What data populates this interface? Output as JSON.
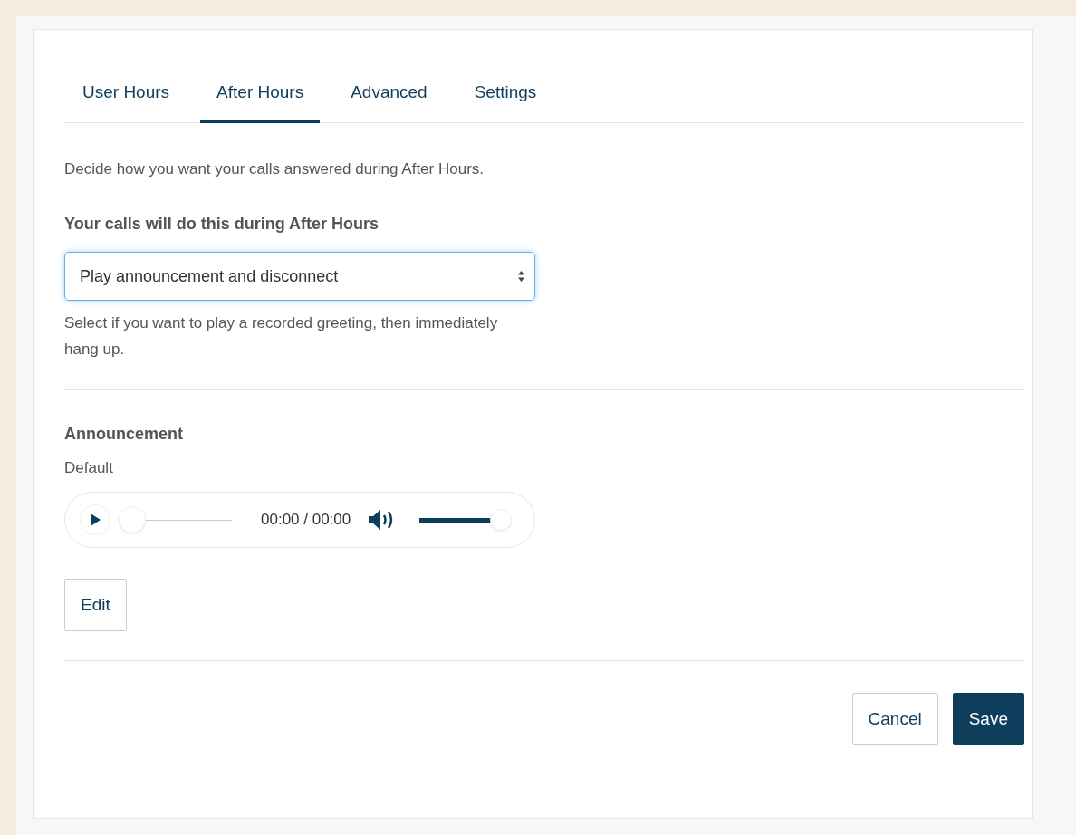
{
  "tabs": [
    {
      "label": "User Hours",
      "selected": false
    },
    {
      "label": "After Hours",
      "selected": true
    },
    {
      "label": "Advanced",
      "selected": false
    },
    {
      "label": "Settings",
      "selected": false
    }
  ],
  "intro": "Decide how you want your calls answered during After Hours.",
  "behavior": {
    "label": "Your calls will do this during After Hours",
    "value": "Play announcement and disconnect",
    "focused": true,
    "help": "Select if you want to play a recorded greeting, then immediately hang up."
  },
  "announcement": {
    "heading": "Announcement",
    "name": "Default",
    "player": {
      "progress": {
        "level": 0
      },
      "time": "00:00 / 00:00",
      "volume": {
        "level": 1
      }
    },
    "edit_button": "Edit"
  },
  "buttons": [
    {
      "label": "Cancel",
      "kind": "secondary"
    },
    {
      "label": "Save",
      "kind": "primary"
    }
  ]
}
